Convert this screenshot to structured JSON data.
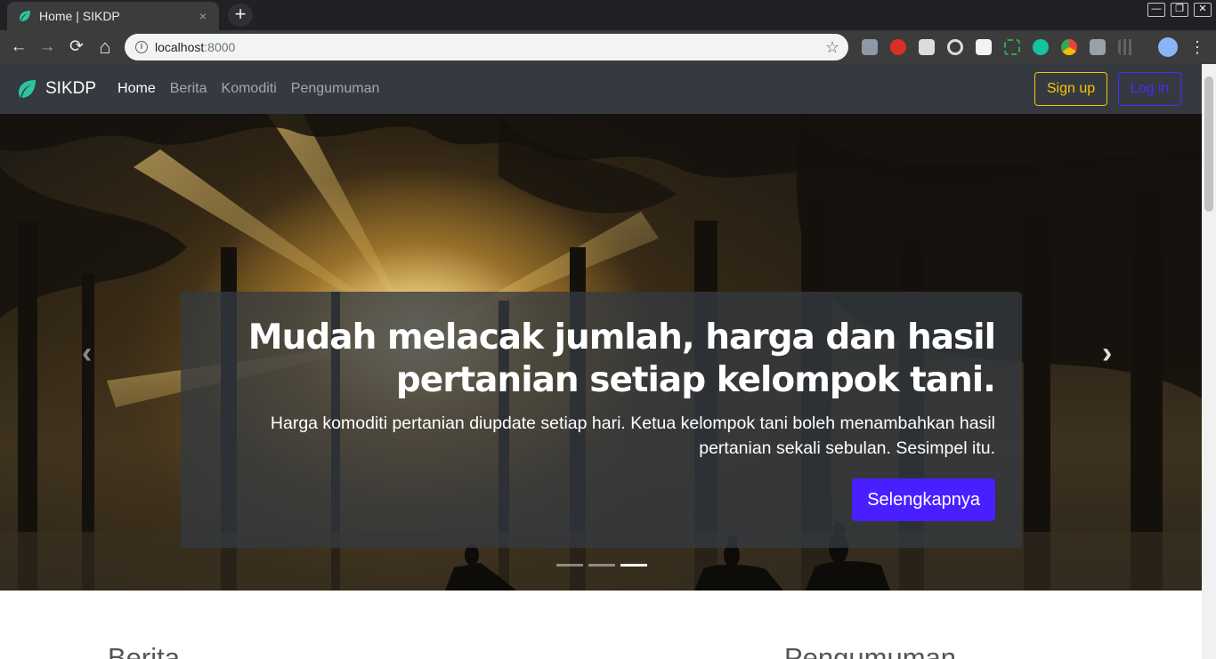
{
  "browser": {
    "tab_title": "Home | SIKDP",
    "tab_close": "×",
    "new_tab": "+",
    "back": "←",
    "forward": "→",
    "reload": "⟳",
    "home": "⌂",
    "url_host": "localhost",
    "url_port": ":8000",
    "bookmark": "☆",
    "menu": "⋮",
    "window_controls": {
      "minimize": "—",
      "maximize": "❐",
      "close": "✕"
    }
  },
  "nav": {
    "brand": "SIKDP",
    "links": [
      {
        "label": "Home",
        "active": true
      },
      {
        "label": "Berita",
        "active": false
      },
      {
        "label": "Komoditi",
        "active": false
      },
      {
        "label": "Pengumuman",
        "active": false
      }
    ],
    "signup_label": "Sign up",
    "login_label": "Log in"
  },
  "hero": {
    "title_line1": "Mudah melacak jumlah, harga dan hasil",
    "title_line2": "pertanian setiap kelompok tani.",
    "subtitle_line1": "Harga komoditi pertanian diupdate setiap hari. Ketua kelompok tani boleh menambahkan hasil",
    "subtitle_line2": "pertanian sekali sebulan. Sesimpel itu.",
    "cta_label": "Selengkapnya",
    "prev_icon": "‹",
    "next_icon": "›",
    "slides_count": 3,
    "active_slide": 3
  },
  "sections": {
    "left_heading": "Berita",
    "right_heading": "Pengumuman"
  },
  "colors": {
    "navbar": "#343a40",
    "signup": "#ffc107",
    "login": "#4a2bff",
    "cta": "#4a1fff",
    "brand_leaf": "#2ec4a0"
  }
}
